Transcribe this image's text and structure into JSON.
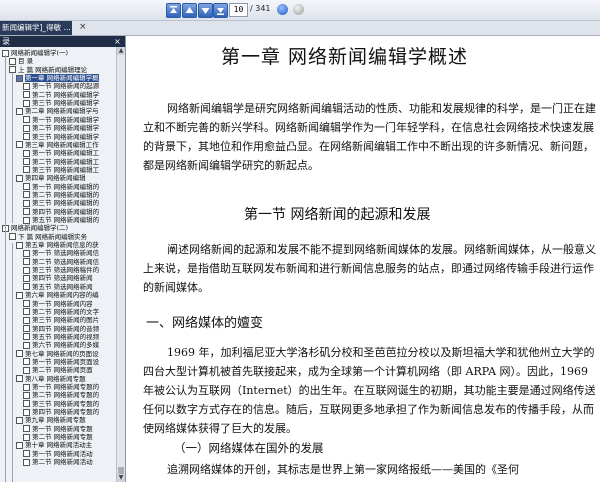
{
  "toolbar": {
    "page_current": "10",
    "page_total": "/ 341"
  },
  "tab": {
    "title": "新闻编辑学]_得敏 ...",
    "close": "×"
  },
  "sidebar": {
    "header": "录",
    "close": "×",
    "items": [
      "网络新闻编辑学(一)",
      "目  录",
      "上  篇   网络新闻编辑理论",
      "第一章   网络新闻编辑学概",
      "第一节   网络新闻的起源",
      "第二节   网络新闻编辑学",
      "第三节   网络新闻编辑学",
      "第二章   网络新闻编辑学与",
      "第一节   网络新闻编辑学",
      "第二节   网络新闻编辑学",
      "第三节   网络新闻编辑学",
      "第三章   网络新闻编辑工作",
      "第一节   网络新闻编辑工",
      "第二节   网络新闻编辑工",
      "第三节   网络新闻编辑工",
      "第四章   网络新闻编辑",
      "第一节   网络新闻编辑的",
      "第二节   网络新闻编辑的",
      "第三节   网络新闻编辑的",
      "第四节   网络新闻编辑的",
      "第五节   网络新闻编辑的",
      "网络新闻编辑学(二)",
      "下  篇   网络新闻编辑实务",
      "第五章   网络新闻信息的获",
      "第一节   筛选网络新闻信",
      "第二节   筛选网络新闻信",
      "第三节   筛选网络稿件的",
      "第四节   筛选网络新闻",
      "第五节   筛选网络新闻",
      "第六章   网络新闻内容的编",
      "第一节   网络新闻内容",
      "第二节   网络新闻的文字",
      "第三节   网络新闻的图片",
      "第四节   网络新闻的音频",
      "第五节   网络新闻的视频",
      "第六节   网络新闻的多媒",
      "第七章   网络新闻的页面设",
      "第一节   网络新闻页面设",
      "第二节   网络新闻页面",
      "第八章   网络新闻专题",
      "第一节   网络新闻专题的",
      "第二节   网络新闻专题的",
      "第三节   网络新闻专题的",
      "第四节   网络新闻专题的",
      "第九章   网络新闻专题",
      "第一节   网络新闻专题",
      "第二节   网络新闻专题",
      "第十章   网络新闻活动主",
      "第一节   网络新闻活动",
      "第二节   网络新闻活动"
    ]
  },
  "document": {
    "chapter_title": "第一章    网络新闻编辑学概述",
    "para1": "网络新闻编辑学是研究网络新闻编辑活动的性质、功能和发展规律的科学，是一门正在建立和不断完善的新兴学科。网络新闻编辑学作为一门年轻学科，在信息社会网络技术快速发展的背景下，其地位和作用愈益凸显。在网络新闻编辑工作中不断出现的许多新情况、新问题，都是网络新闻编辑学研究的新起点。",
    "section_title": "第一节    网络新闻的起源和发展",
    "para2": "阐述网络新闻的起源和发展不能不提到网络新闻媒体的发展。网络新闻媒体，从一般意义上来说，是指借助互联网发布新闻和进行新闻信息服务的站点，即通过网络传输手段进行运作的新闻媒体。",
    "subsection_title": "一、网络媒体的嬗变",
    "para3": "1969 年，加利福尼亚大学洛杉矶分校和圣芭芭拉分校以及斯坦福大学和犹他州立大学的四台大型计算机被首先联接起来，成为全球第一个计算机网络（即 ARPA 网）。因此，1969 年被公认为互联网（Internet）的出生年。在互联网诞生的初期，其功能主要是通过网络传送任何以数字方式存在的信息。随后，互联网更多地承担了作为新闻信息发布的传播手段，从而使网络媒体获得了巨大的发展。",
    "subsubsection_title": "（一）网络媒体在国外的发展",
    "para4": "追溯网络媒体的开创，其标志是世界上第一家网络报纸——美国的《圣何"
  }
}
